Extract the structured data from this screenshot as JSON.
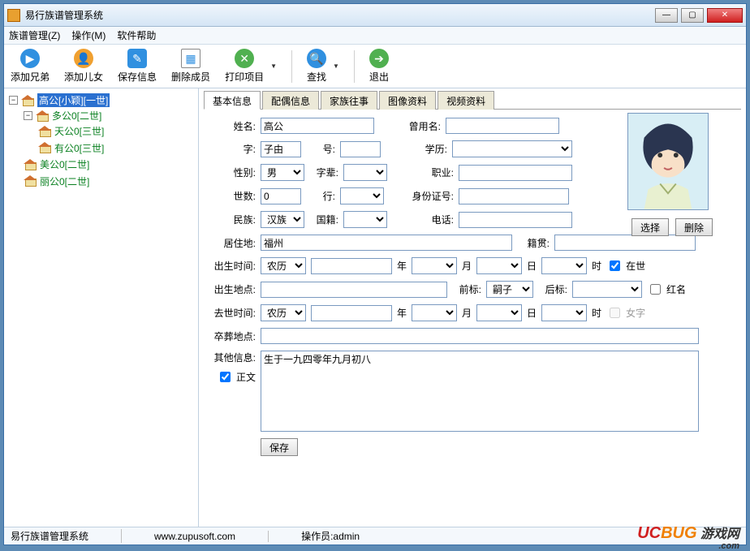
{
  "window": {
    "title": "易行族谱管理系统"
  },
  "menu": {
    "zupu": "族谱管理(Z)",
    "ops": "操作(M)",
    "help": "软件帮助"
  },
  "toolbar": {
    "addBrother": "添加兄弟",
    "addChild": "添加儿女",
    "save": "保存信息",
    "delete": "删除成员",
    "print": "打印项目",
    "search": "查找",
    "exit": "退出"
  },
  "tree": {
    "n1": "高公[小颖][一世]",
    "n2": "多公0[二世]",
    "n3": "天公0[三世]",
    "n4": "有公0[三世]",
    "n5": "美公0[二世]",
    "n6": "丽公0[二世]"
  },
  "tabs": {
    "basic": "基本信息",
    "spouse": "配偶信息",
    "family": "家族往事",
    "image": "图像资料",
    "video": "视频资料"
  },
  "labels": {
    "name": "姓名:",
    "formerName": "曾用名:",
    "zi": "字:",
    "hao": "号:",
    "edu": "学历:",
    "gender": "性别:",
    "zibei": "字辈:",
    "job": "职业:",
    "gen": "世数:",
    "hang": "行:",
    "idcard": "身份证号:",
    "ethnic": "民族:",
    "nation": "国籍:",
    "phone": "电话:",
    "addr": "居住地:",
    "origin": "籍贯:",
    "birthTime": "出生时间:",
    "year": "年",
    "month": "月",
    "day": "日",
    "hour": "时",
    "alive": "在世",
    "birthPlace": "出生地点:",
    "qianbiao": "前标:",
    "houbiao": "后标:",
    "red": "红名",
    "deathTime": "去世时间:",
    "nvzi": "女字",
    "buryPlace": "卒葬地点:",
    "other": "其他信息:",
    "zhengwen": "正文",
    "btnSave": "保存",
    "btnSelect": "选择",
    "btnDelete": "删除"
  },
  "values": {
    "name": "高公",
    "zi": "子由",
    "gender": "男",
    "gen": "0",
    "ethnic": "汉族",
    "addr": "福州",
    "birthCal": "农历",
    "deathCal": "农历",
    "qianbiao": "嗣子",
    "other": "生于一九四零年九月初八"
  },
  "status": {
    "app": "易行族谱管理系统",
    "url": "www.zupusoft.com",
    "operator": "操作员:admin"
  },
  "brand": {
    "uc": "UC",
    "bug": "BUG",
    "cn": " 游戏网",
    "com": ".com"
  }
}
